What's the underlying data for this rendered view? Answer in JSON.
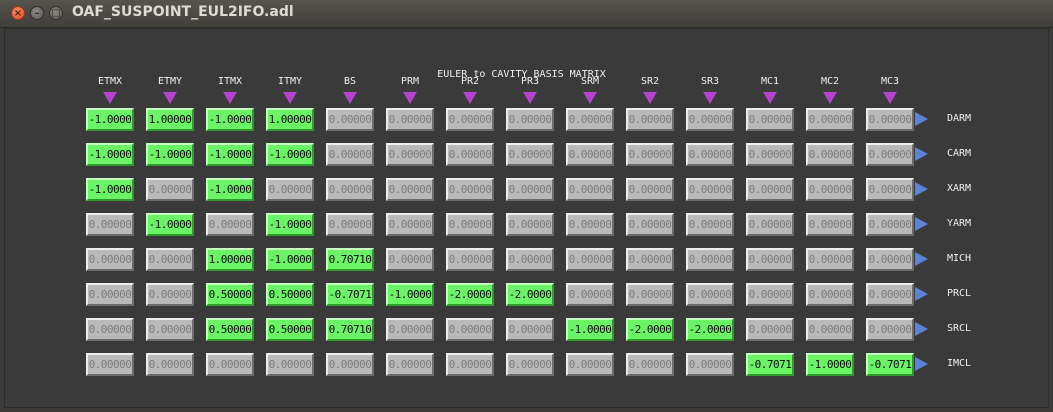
{
  "window": {
    "title": "OAF_SUSPOINT_EUL2IFO.adl"
  },
  "matrix": {
    "title": "EULER to CAVITY BASIS MATRIX",
    "columns": [
      "ETMX",
      "ETMY",
      "ITMX",
      "ITMY",
      "BS",
      "PRM",
      "PR2",
      "PR3",
      "SRM",
      "SR2",
      "SR3",
      "MC1",
      "MC2",
      "MC3"
    ],
    "rows": [
      {
        "label": "DARM",
        "values": [
          "-1.0000",
          "1.00000",
          "-1.0000",
          "1.00000",
          "0.00000",
          "0.00000",
          "0.00000",
          "0.00000",
          "0.00000",
          "0.00000",
          "0.00000",
          "0.00000",
          "0.00000",
          "0.00000"
        ]
      },
      {
        "label": "CARM",
        "values": [
          "-1.0000",
          "-1.0000",
          "-1.0000",
          "-1.0000",
          "0.00000",
          "0.00000",
          "0.00000",
          "0.00000",
          "0.00000",
          "0.00000",
          "0.00000",
          "0.00000",
          "0.00000",
          "0.00000"
        ]
      },
      {
        "label": "XARM",
        "values": [
          "-1.0000",
          "0.00000",
          "-1.0000",
          "0.00000",
          "0.00000",
          "0.00000",
          "0.00000",
          "0.00000",
          "0.00000",
          "0.00000",
          "0.00000",
          "0.00000",
          "0.00000",
          "0.00000"
        ]
      },
      {
        "label": "YARM",
        "values": [
          "0.00000",
          "-1.0000",
          "0.00000",
          "-1.0000",
          "0.00000",
          "0.00000",
          "0.00000",
          "0.00000",
          "0.00000",
          "0.00000",
          "0.00000",
          "0.00000",
          "0.00000",
          "0.00000"
        ]
      },
      {
        "label": "MICH",
        "values": [
          "0.00000",
          "0.00000",
          "1.00000",
          "-1.0000",
          "0.70710",
          "0.00000",
          "0.00000",
          "0.00000",
          "0.00000",
          "0.00000",
          "0.00000",
          "0.00000",
          "0.00000",
          "0.00000"
        ]
      },
      {
        "label": "PRCL",
        "values": [
          "0.00000",
          "0.00000",
          "0.50000",
          "0.50000",
          "-0.7071",
          "-1.0000",
          "-2.0000",
          "-2.0000",
          "0.00000",
          "0.00000",
          "0.00000",
          "0.00000",
          "0.00000",
          "0.00000"
        ]
      },
      {
        "label": "SRCL",
        "values": [
          "0.00000",
          "0.00000",
          "0.50000",
          "0.50000",
          "0.70710",
          "0.00000",
          "0.00000",
          "0.00000",
          "-1.0000",
          "-2.0000",
          "-2.0000",
          "0.00000",
          "0.00000",
          "0.00000"
        ]
      },
      {
        "label": "IMCL",
        "values": [
          "0.00000",
          "0.00000",
          "0.00000",
          "0.00000",
          "0.00000",
          "0.00000",
          "0.00000",
          "0.00000",
          "0.00000",
          "0.00000",
          "0.00000",
          "-0.7071",
          "-1.0000",
          "-0.7071"
        ]
      }
    ]
  },
  "colors": {
    "nonzero_cell": "#6bf466",
    "zero_cell": "#b9b9b9",
    "column_arrow": "#b542cc",
    "row_arrow": "#5b83d8",
    "background": "#3c3b37"
  },
  "icons": {
    "close": "close-icon",
    "minimize": "minimize-icon",
    "maximize": "maximize-icon",
    "column_arrow": "down-arrow-icon",
    "row_arrow": "right-arrow-icon"
  }
}
